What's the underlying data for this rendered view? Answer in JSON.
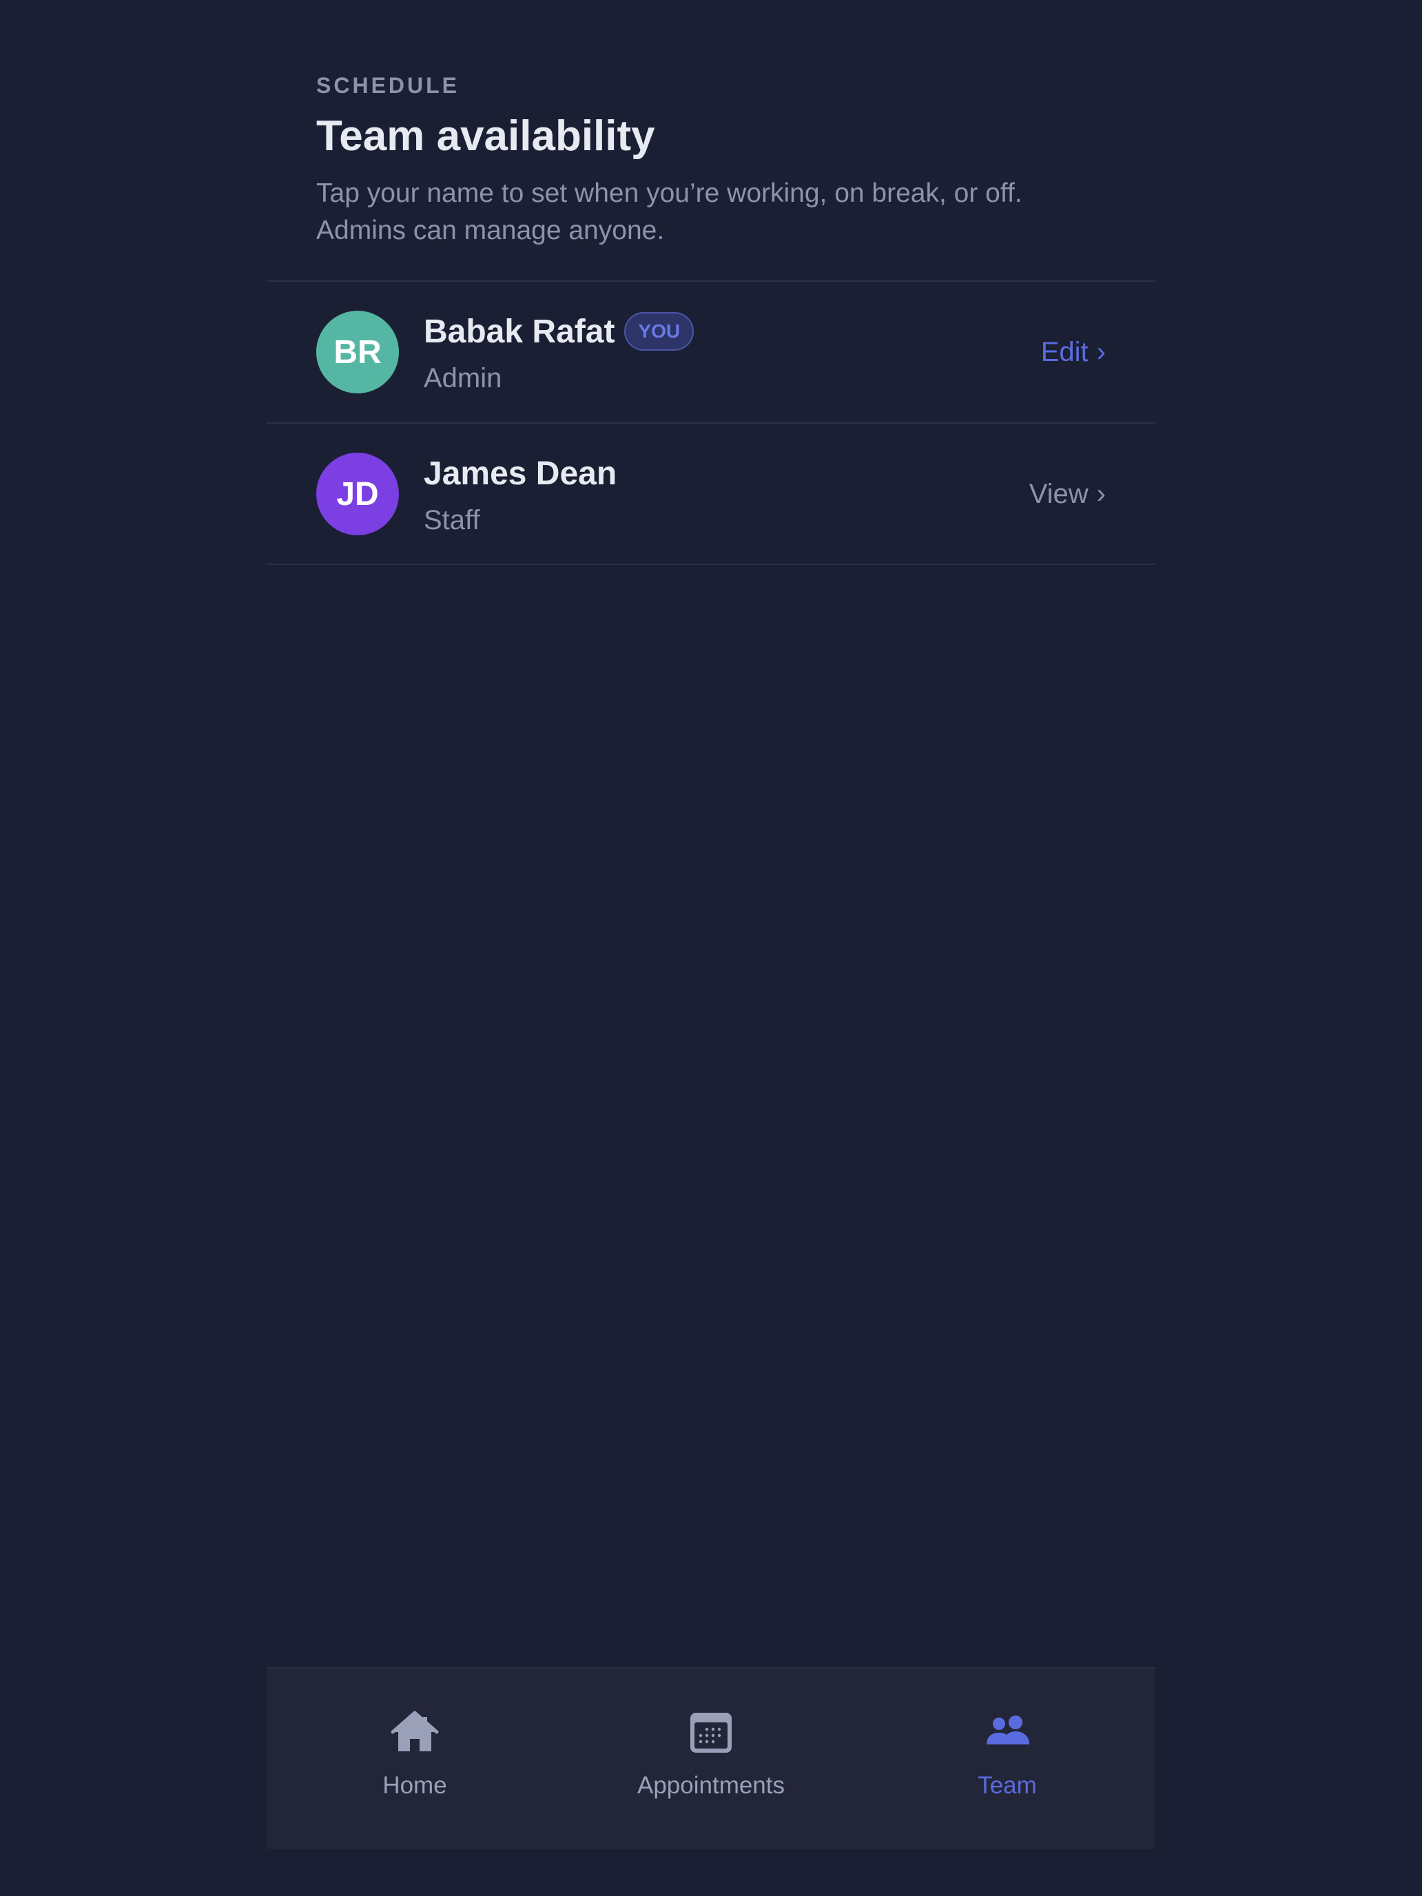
{
  "header": {
    "overline": "SCHEDULE",
    "title": "Team availability",
    "subtitle_line1": "Tap your name to set when you’re working, on break, or off.",
    "subtitle_line2": "Admins can manage anyone."
  },
  "members": [
    {
      "initials": "BR",
      "name": "Babak Rafat",
      "badge": "YOU",
      "role": "Admin",
      "action": "Edit",
      "avatar_color": "#55b7a3",
      "action_color": "#5a6be0"
    },
    {
      "initials": "JD",
      "name": "James Dean",
      "role": "Staff",
      "action": "View",
      "avatar_color": "#7b3fe4",
      "action_color": "#8e93aa"
    }
  ],
  "tabbar": {
    "tabs": [
      {
        "label": "Home",
        "icon": "home-icon",
        "active": false
      },
      {
        "label": "Appointments",
        "icon": "calendar-icon",
        "active": false
      },
      {
        "label": "Team",
        "icon": "team-icon",
        "active": true
      }
    ],
    "active_color": "#5a6be0",
    "inactive_color": "#9aa0b8"
  },
  "colors": {
    "background": "#1b1f33",
    "tabbar_background": "#232638",
    "divider": "#2c3047"
  }
}
